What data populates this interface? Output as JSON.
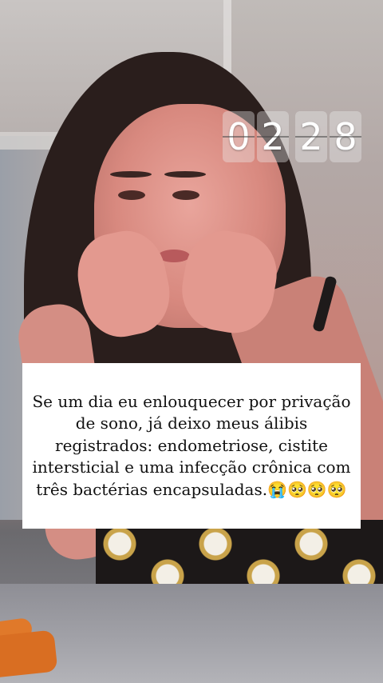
{
  "clock": {
    "digits": [
      "0",
      "2",
      "2",
      "8"
    ]
  },
  "caption": {
    "text": "Se um dia eu enlouquecer por privação de sono, já deixo meus álibis registrados: endometriose, cistite intersticial e uma infecção crônica com três bactérias encapsuladas.😭🥺🥺🥺"
  },
  "colors": {
    "caption_background": "#ffffff",
    "caption_text": "#111111",
    "clock_digit": "#ffffff"
  }
}
